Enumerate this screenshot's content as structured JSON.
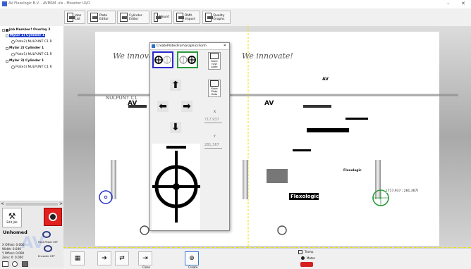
{
  "window": {
    "title": "AV Flexologic B.V. - AVMSM .xls - Mounter UI/O",
    "minimize": "–",
    "close": "✕"
  },
  "toolbar": {
    "buttons": [
      {
        "label": "Jobs List"
      },
      {
        "label": "Plate Editor"
      },
      {
        "label": "Cylinder Editor"
      },
      {
        "label": "Mount"
      },
      {
        "label": "DMA Import"
      },
      {
        "label": "Quality Graphs"
      }
    ]
  },
  "tree": {
    "items": [
      {
        "label": "Job Number! Overlay 2"
      },
      {
        "label": "Mylar 1) Cylinder 1"
      },
      {
        "label": "Plate2) NULPUNT C1  R"
      },
      {
        "label": "Mylar 2) Cylinder 1"
      },
      {
        "label": "Plate1) NULPUNT C1  R"
      },
      {
        "label": "Mylar 3) Cylinder 1"
      },
      {
        "label": "Plate1) NULPUNT C1  R"
      }
    ],
    "scroll_left": "<",
    "scroll_right": ">"
  },
  "leftpanel": {
    "edit_job": "Edit Job",
    "status": "Unhomed",
    "x_offset": "X Offset: 0.000",
    "width": "Width: 0.000",
    "y_offset": "Y Offset: 0.000",
    "zero": "Zero: X: 0.000",
    "pivot_pedal": "Foot Pedal OFF",
    "encoder": "Encoder OFF"
  },
  "canvas": {
    "slogan": "We innovate!",
    "plate_label": "NULPUNT C1",
    "brand": "AV",
    "flexologic": "Flexologic",
    "flexologic_small": "Flexologic",
    "coords_readout": "[717,937 ; 281,367]"
  },
  "dialog": {
    "title": "CreatePlatesFromGraphicsForm",
    "close": "✕",
    "store_btn": "Store new plate",
    "store_data": "Store Plate Data",
    "x_label": "X",
    "x_value": "717,937",
    "y_label": "Y",
    "y_value": "281,367"
  },
  "bottombar": {
    "close": "Close",
    "create": "Create",
    "tramp": "Tramp",
    "mates": "Mates"
  }
}
